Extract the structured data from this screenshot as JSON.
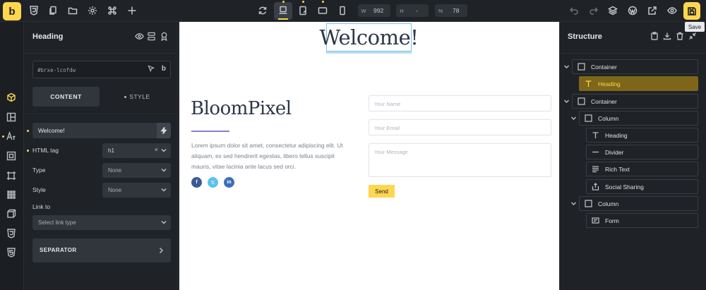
{
  "toolbar": {
    "logo": "b",
    "width_label": "W",
    "width_value": "992",
    "height_label": "H",
    "height_value": "-",
    "zoom_label": "%",
    "zoom_value": "78",
    "save_tooltip": "Save",
    "accent": "#ffd64f"
  },
  "left_panel": {
    "title": "Heading",
    "element_id": "#brxe-lcofdw",
    "tabs": {
      "content": "CONTENT",
      "style": "STYLE"
    },
    "text_value": "Welcome!",
    "fields": {
      "html_tag": {
        "label": "HTML tag",
        "value": "h1"
      },
      "type": {
        "label": "Type",
        "value": "None"
      },
      "style": {
        "label": "Style",
        "value": "None"
      },
      "link_to": {
        "label": "Link to",
        "placeholder": "Select link type"
      }
    },
    "separator": "SEPARATOR"
  },
  "canvas": {
    "heading": "Welcome!",
    "brand": "BloomPixel",
    "richtext": "Lorem ipsum dolor sit amet, consectetur adipiscing elit. Ut aliquam, ex sed hendrerit egestas, libero tellus suscipit mauris, vitae lacinia ante lacus sed orci.",
    "form": {
      "name_placeholder": "Your Name",
      "email_placeholder": "Your Email",
      "message_placeholder": "Your Message",
      "send": "Send"
    },
    "social": [
      {
        "name": "facebook",
        "glyph": "f",
        "color": "#3b5998"
      },
      {
        "name": "x",
        "glyph": "𝕏",
        "color": "#5bc2f0"
      },
      {
        "name": "linkedin",
        "glyph": "in",
        "color": "#3c6fb4"
      }
    ],
    "divider_color": "#8b80c9"
  },
  "structure": {
    "title": "Structure",
    "nodes": [
      {
        "label": "Container",
        "icon": "square-icon"
      },
      {
        "label": "Heading",
        "icon": "heading-icon",
        "active": true
      },
      {
        "label": "Container",
        "icon": "square-icon"
      },
      {
        "label": "Column",
        "icon": "square-icon"
      },
      {
        "label": "Heading",
        "icon": "heading-icon"
      },
      {
        "label": "Divider",
        "icon": "divider-icon"
      },
      {
        "label": "Rich Text",
        "icon": "richtext-icon"
      },
      {
        "label": "Social Sharing",
        "icon": "share-icon"
      },
      {
        "label": "Column",
        "icon": "square-icon"
      },
      {
        "label": "Form",
        "icon": "form-icon"
      }
    ]
  }
}
